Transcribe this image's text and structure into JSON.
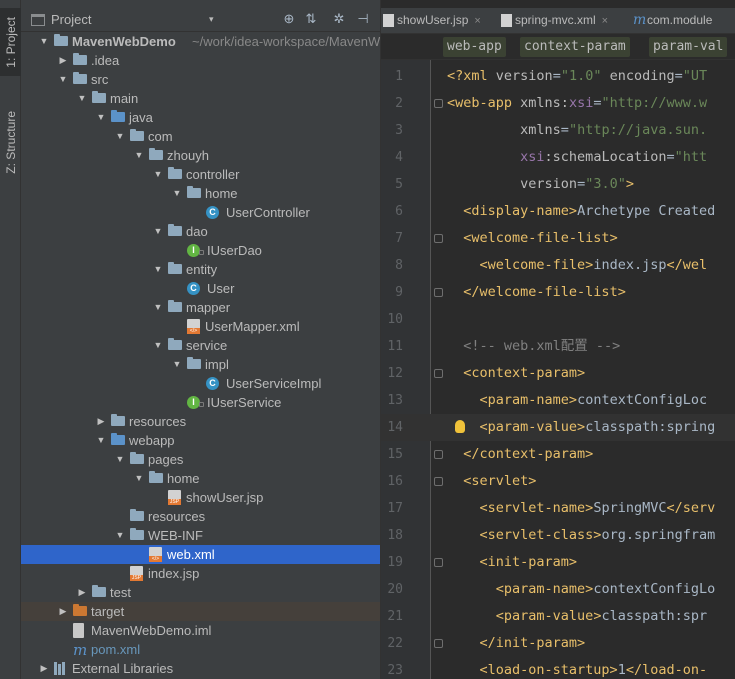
{
  "toolwindows": {
    "project_tab": "1: Project",
    "structure_tab": "Z: Structure"
  },
  "project_panel": {
    "title": "Project",
    "dropdown": "▾",
    "icon_locate": "⊕",
    "icon_collapse": "⇅",
    "icon_settings": "✲",
    "icon_hide": "⊣"
  },
  "tree": [
    {
      "label": "MavenWebDemo",
      "extra": "~/work/idea-workspace/MavenW",
      "icon": "folder-module",
      "arrow": "▼",
      "bold": true
    },
    {
      "label": ".idea",
      "icon": "folder",
      "arrow": "▶"
    },
    {
      "label": "src",
      "icon": "folder",
      "arrow": "▼"
    },
    {
      "label": "main",
      "icon": "folder",
      "arrow": "▼"
    },
    {
      "label": "java",
      "icon": "folder-source",
      "arrow": "▼"
    },
    {
      "label": "com",
      "icon": "folder",
      "arrow": "▼"
    },
    {
      "label": "zhouyh",
      "icon": "folder",
      "arrow": "▼"
    },
    {
      "label": "controller",
      "icon": "folder",
      "arrow": "▼"
    },
    {
      "label": "home",
      "icon": "folder",
      "arrow": "▼"
    },
    {
      "label": "UserController",
      "icon": "class",
      "glyph": "C"
    },
    {
      "label": "dao",
      "icon": "folder",
      "arrow": "▼"
    },
    {
      "label": "IUserDao",
      "icon": "interface",
      "glyph": "I"
    },
    {
      "label": "entity",
      "icon": "folder",
      "arrow": "▼"
    },
    {
      "label": "User",
      "icon": "class",
      "glyph": "C"
    },
    {
      "label": "mapper",
      "icon": "folder",
      "arrow": "▼"
    },
    {
      "label": "UserMapper.xml",
      "icon": "xml-file"
    },
    {
      "label": "service",
      "icon": "folder",
      "arrow": "▼"
    },
    {
      "label": "impl",
      "icon": "folder",
      "arrow": "▼"
    },
    {
      "label": "UserServiceImpl",
      "icon": "class",
      "glyph": "C"
    },
    {
      "label": "IUserService",
      "icon": "interface",
      "glyph": "I"
    },
    {
      "label": "resources",
      "icon": "folder-resources",
      "arrow": "▶"
    },
    {
      "label": "webapp",
      "icon": "folder-web",
      "arrow": "▼"
    },
    {
      "label": "pages",
      "icon": "folder",
      "arrow": "▼"
    },
    {
      "label": "home",
      "icon": "folder",
      "arrow": "▼"
    },
    {
      "label": "showUser.jsp",
      "icon": "jsp-file"
    },
    {
      "label": "resources",
      "icon": "folder"
    },
    {
      "label": "WEB-INF",
      "icon": "folder",
      "arrow": "▼"
    },
    {
      "label": "web.xml",
      "icon": "xml-file",
      "selected": true
    },
    {
      "label": "index.jsp",
      "icon": "jsp-file"
    },
    {
      "label": "test",
      "icon": "folder",
      "arrow": "▶"
    },
    {
      "label": "target",
      "icon": "folder-excluded",
      "arrow": "▶",
      "ignored": true
    },
    {
      "label": "MavenWebDemo.iml",
      "icon": "iml-file"
    },
    {
      "label": "pom.xml",
      "icon": "maven-file",
      "glyph": "m"
    },
    {
      "label": "External Libraries",
      "icon": "libraries",
      "arrow": "▶"
    }
  ],
  "editor": {
    "tabs": [
      {
        "label": "showUser.jsp",
        "close": "×"
      },
      {
        "label": "spring-mvc.xml",
        "close": "×"
      },
      {
        "label": "com.module",
        "glyph": "m"
      }
    ],
    "breadcrumbs": [
      "web-app",
      "context-param",
      "param-val"
    ],
    "lines": [
      {
        "n": "1",
        "parts": [
          [
            "tag",
            "<?xml "
          ],
          [
            "attr",
            "version"
          ],
          [
            "txt",
            "="
          ],
          [
            "val",
            "\"1.0\""
          ],
          [
            "txt",
            " "
          ],
          [
            "attr",
            "encoding"
          ],
          [
            "txt",
            "="
          ],
          [
            "val",
            "\"UT"
          ]
        ]
      },
      {
        "n": "2",
        "fold": true,
        "parts": [
          [
            "tag",
            "<web-app "
          ],
          [
            "attr",
            "xmlns:"
          ],
          [
            "ns",
            "xsi"
          ],
          [
            "txt",
            "="
          ],
          [
            "val",
            "\"http://www.w"
          ]
        ]
      },
      {
        "n": "3",
        "parts": [
          [
            "txt",
            "         "
          ],
          [
            "attr",
            "xmlns"
          ],
          [
            "txt",
            "="
          ],
          [
            "val",
            "\"http://java.sun."
          ]
        ]
      },
      {
        "n": "4",
        "parts": [
          [
            "txt",
            "         "
          ],
          [
            "ns",
            "xsi"
          ],
          [
            "attr",
            ":schemaLocation"
          ],
          [
            "txt",
            "="
          ],
          [
            "val",
            "\"htt"
          ]
        ]
      },
      {
        "n": "5",
        "parts": [
          [
            "txt",
            "         "
          ],
          [
            "attr",
            "version"
          ],
          [
            "txt",
            "="
          ],
          [
            "val",
            "\"3.0\""
          ],
          [
            "tag",
            ">"
          ]
        ]
      },
      {
        "n": "6",
        "parts": [
          [
            "txt",
            "  "
          ],
          [
            "tag",
            "<display-name>"
          ],
          [
            "txt",
            "Archetype Created"
          ]
        ]
      },
      {
        "n": "7",
        "fold": true,
        "parts": [
          [
            "txt",
            "  "
          ],
          [
            "tag",
            "<welcome-file-list>"
          ]
        ]
      },
      {
        "n": "8",
        "parts": [
          [
            "txt",
            "    "
          ],
          [
            "tag",
            "<welcome-file>"
          ],
          [
            "txt",
            "index.jsp"
          ],
          [
            "tag",
            "</wel"
          ]
        ]
      },
      {
        "n": "9",
        "fold": true,
        "parts": [
          [
            "txt",
            "  "
          ],
          [
            "tag",
            "</welcome-file-list>"
          ]
        ]
      },
      {
        "n": "10",
        "parts": []
      },
      {
        "n": "11",
        "parts": [
          [
            "txt",
            "  "
          ],
          [
            "com",
            "<!-- web.xml配置 -->"
          ]
        ]
      },
      {
        "n": "12",
        "fold": true,
        "parts": [
          [
            "txt",
            "  "
          ],
          [
            "tag",
            "<context-param>"
          ]
        ]
      },
      {
        "n": "13",
        "parts": [
          [
            "txt",
            "    "
          ],
          [
            "tag",
            "<param-name>"
          ],
          [
            "txt",
            "contextConfigLoc"
          ]
        ]
      },
      {
        "n": "14",
        "bulb": true,
        "current": true,
        "parts": [
          [
            "txt",
            "    "
          ],
          [
            "tag",
            "<param-value>"
          ],
          [
            "txt",
            "classpath:spring"
          ]
        ]
      },
      {
        "n": "15",
        "fold": true,
        "parts": [
          [
            "txt",
            "  "
          ],
          [
            "tag",
            "</context-param>"
          ]
        ]
      },
      {
        "n": "16",
        "fold": true,
        "parts": [
          [
            "txt",
            "  "
          ],
          [
            "tag",
            "<servlet>"
          ]
        ]
      },
      {
        "n": "17",
        "parts": [
          [
            "txt",
            "    "
          ],
          [
            "tag",
            "<servlet-name>"
          ],
          [
            "txt",
            "SpringMVC"
          ],
          [
            "tag",
            "</serv"
          ]
        ]
      },
      {
        "n": "18",
        "parts": [
          [
            "txt",
            "    "
          ],
          [
            "tag",
            "<servlet-class>"
          ],
          [
            "txt",
            "org.springfram"
          ]
        ]
      },
      {
        "n": "19",
        "fold": true,
        "parts": [
          [
            "txt",
            "    "
          ],
          [
            "tag",
            "<init-param>"
          ]
        ]
      },
      {
        "n": "20",
        "parts": [
          [
            "txt",
            "      "
          ],
          [
            "tag",
            "<param-name>"
          ],
          [
            "txt",
            "contextConfigLo"
          ]
        ]
      },
      {
        "n": "21",
        "parts": [
          [
            "txt",
            "      "
          ],
          [
            "tag",
            "<param-value>"
          ],
          [
            "txt",
            "classpath:spr"
          ]
        ]
      },
      {
        "n": "22",
        "fold": true,
        "parts": [
          [
            "txt",
            "    "
          ],
          [
            "tag",
            "</init-param>"
          ]
        ]
      },
      {
        "n": "23",
        "parts": [
          [
            "txt",
            "    "
          ],
          [
            "tag",
            "<load-on-startup>"
          ],
          [
            "txt",
            "1"
          ],
          [
            "tag",
            "</load-on-"
          ]
        ]
      }
    ]
  }
}
